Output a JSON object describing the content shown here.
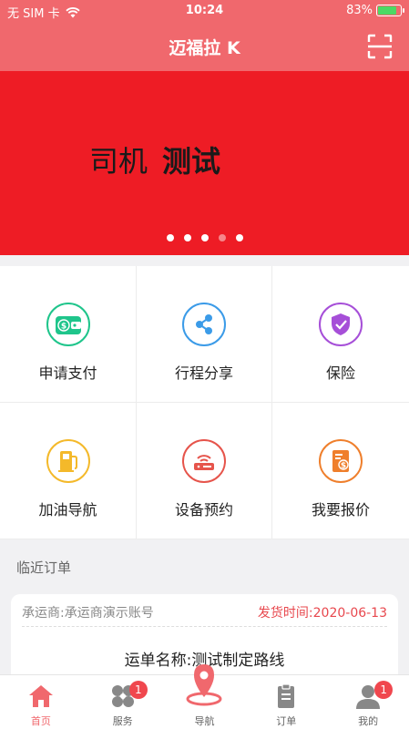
{
  "status_bar": {
    "carrier": "无 SIM 卡",
    "time": "10:24",
    "battery": "83%",
    "battery_level": 0.83
  },
  "header": {
    "title": "迈福拉 K",
    "scan_icon": "scan-icon"
  },
  "banner": {
    "text_normal": "司机",
    "text_bold": "测试",
    "background": "#ee1c25",
    "page_count": 5,
    "active_page": 3
  },
  "services": [
    {
      "label": "申请支付",
      "icon": "wallet-icon",
      "color": "#1fc58b"
    },
    {
      "label": "行程分享",
      "icon": "share-icon",
      "color": "#3b9be8"
    },
    {
      "label": "保险",
      "icon": "shield-icon",
      "color": "#a64fd8"
    },
    {
      "label": "加油导航",
      "icon": "fuel-icon",
      "color": "#f4b92a"
    },
    {
      "label": "设备预约",
      "icon": "router-icon",
      "color": "#e6544b"
    },
    {
      "label": "我要报价",
      "icon": "invoice-icon",
      "color": "#ef7f2c"
    }
  ],
  "recent_orders": {
    "title": "临近订单",
    "order": {
      "carrier": "承运商:承运商演示账号",
      "ship_time": "发货时间:2020-06-13",
      "route_name": "运单名称:测试制定路线"
    }
  },
  "tab_bar": [
    {
      "label": "首页",
      "icon": "home-icon",
      "active": true,
      "badge": ""
    },
    {
      "label": "服务",
      "icon": "services-icon",
      "active": false,
      "badge": "1"
    },
    {
      "label": "导航",
      "icon": "location-pin-icon",
      "active": false,
      "badge": ""
    },
    {
      "label": "订单",
      "icon": "clipboard-icon",
      "active": false,
      "badge": ""
    },
    {
      "label": "我的",
      "icon": "user-icon",
      "active": false,
      "badge": "1"
    }
  ],
  "colors": {
    "brand": "#f0686d",
    "accent_red": "#e8484e"
  }
}
